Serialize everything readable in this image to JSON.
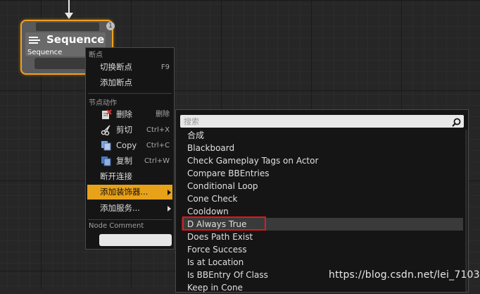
{
  "node": {
    "title": "Sequence",
    "subtitle": "Sequence",
    "badge": "1",
    "border_color": "#f0a020"
  },
  "context_menu": {
    "section_breakpoints": "断点",
    "toggle_breakpoint": "切换断点",
    "toggle_breakpoint_shortcut": "F9",
    "add_breakpoint": "添加断点",
    "section_node_actions": "节点动作",
    "delete": "删除",
    "delete_shortcut": "删除",
    "delete_icon": "delete-icon",
    "cut": "剪切",
    "cut_shortcut": "Ctrl+X",
    "cut_icon": "scissors-icon",
    "copy": "Copy",
    "copy_shortcut": "Ctrl+C",
    "copy_icon": "copy-icon",
    "duplicate": "复制",
    "duplicate_shortcut": "Ctrl+W",
    "duplicate_icon": "duplicate-icon",
    "break_links": "断开连接",
    "add_decorator": "添加装饰器...",
    "add_service": "添加服务...",
    "section_node_comment": "Node Comment",
    "comment_value": "",
    "highlight_color": "#e8a21a"
  },
  "submenu": {
    "search_placeholder": "搜索",
    "items": [
      "合成",
      "Blackboard",
      "Check Gameplay Tags on Actor",
      "Compare BBEntries",
      "Conditional Loop",
      "Cone Check",
      "Cooldown",
      "D Always True",
      "Does Path Exist",
      "Force Success",
      "Is at Location",
      "Is BBEntry Of Class",
      "Keep in Cone"
    ],
    "hovered_item": "D Always True",
    "highlight_box_color": "#e01818"
  },
  "watermark": "https://blog.csdn.net/lei_7103"
}
